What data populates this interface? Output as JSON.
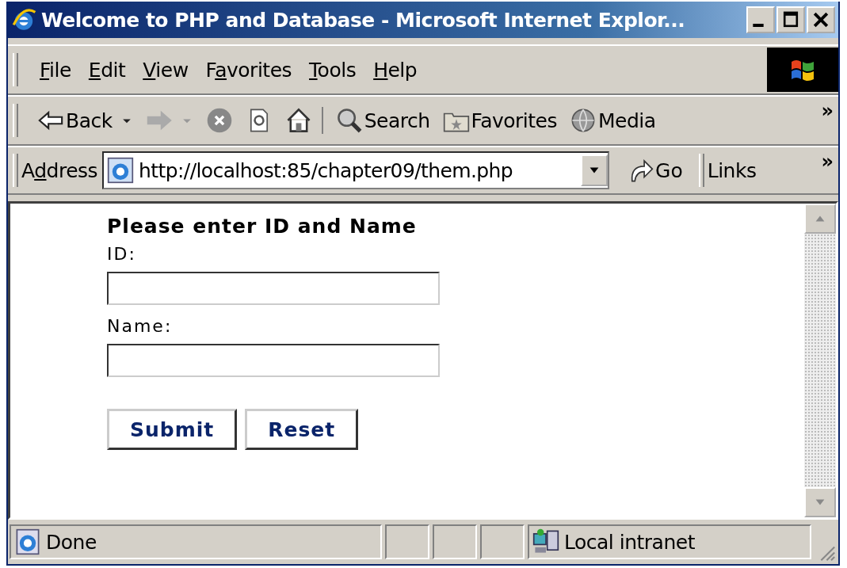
{
  "window": {
    "title": "Welcome to PHP and Database - Microsoft Internet Explor..."
  },
  "menu": [
    {
      "key": "F",
      "post": "ile"
    },
    {
      "key": "E",
      "post": "dit"
    },
    {
      "key": "V",
      "post": "iew"
    },
    {
      "pre": "F",
      "key": "a",
      "post": "vorites"
    },
    {
      "key": "T",
      "post": "ools"
    },
    {
      "key": "H",
      "post": "elp"
    }
  ],
  "toolbar": {
    "buttons": [
      {
        "kind": "back",
        "label": "Back",
        "disabled": false
      },
      {
        "kind": "forward",
        "disabled": true
      },
      {
        "kind": "stop"
      },
      {
        "kind": "refresh"
      },
      {
        "kind": "home"
      },
      {
        "kind": "search",
        "label": "Search"
      },
      {
        "kind": "favorites",
        "label": "Favorites"
      },
      {
        "kind": "media",
        "label": "Media"
      }
    ],
    "overflow": "»"
  },
  "address": {
    "pre": "A",
    "key": "d",
    "post": "dress",
    "value": "http://localhost:85/chapter09/them.php",
    "go": "Go",
    "links": "Links",
    "links_overflow": "»"
  },
  "form": {
    "heading": "Please enter ID and Name",
    "fields": [
      {
        "label": "ID:"
      },
      {
        "label": "Name:"
      }
    ],
    "buttons": [
      {
        "label": "Submit"
      },
      {
        "label": "Reset"
      }
    ]
  },
  "status_bar": {
    "text": "Done",
    "zone": "Local intranet"
  }
}
